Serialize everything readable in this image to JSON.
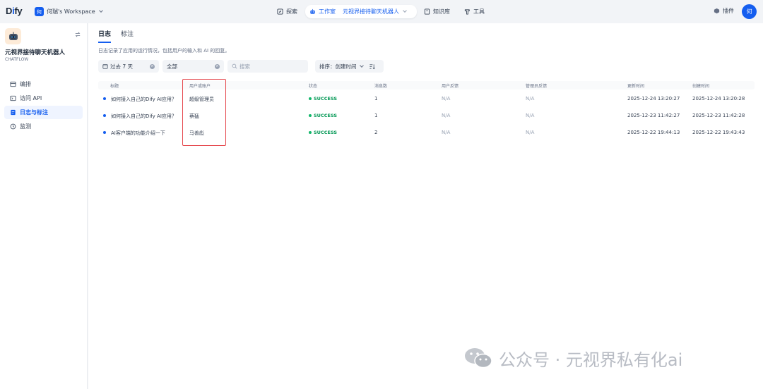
{
  "topbar": {
    "logo_prefix": "D",
    "logo_i": "i",
    "logo_suffix": "fy",
    "workspace_avatar": "何",
    "workspace_name": "何瑞's Workspace",
    "nav": {
      "explore": "探索",
      "studio": "工作室",
      "studio_app": "元视界接待聊天机器人",
      "knowledge": "知识库",
      "tools": "工具"
    },
    "plugin": "插件",
    "user_avatar": "何"
  },
  "sidebar": {
    "app_name": "元视界接待聊天机器人",
    "app_type": "CHATFLOW",
    "items": [
      {
        "label": "编排",
        "icon": "layout-icon"
      },
      {
        "label": "访问 API",
        "icon": "terminal-icon"
      },
      {
        "label": "日志与标注",
        "icon": "file-text-icon",
        "active": true
      },
      {
        "label": "监测",
        "icon": "monitor-icon"
      }
    ]
  },
  "main": {
    "tabs": [
      "日志",
      "标注"
    ],
    "description": "日志记录了应用的运行情况，包括用户的输入和 AI 的回复。",
    "filters": {
      "period": "过去 7 天",
      "status": "全部",
      "search_placeholder": "搜索",
      "sort": "排序：创建时间"
    },
    "table": {
      "headers": [
        "标题",
        "用户或账户",
        "状态",
        "消息数",
        "用户反馈",
        "管理员反馈",
        "更新时间",
        "创建时间"
      ],
      "rows": [
        {
          "title": "如何接入自己的Dify AI应用？",
          "user": "超级管理员",
          "status": "SUCCESS",
          "messages": "1",
          "user_feedback": "N/A",
          "admin_feedback": "N/A",
          "updated": "2025-12-24 13:20:27",
          "created": "2025-12-24 13:20:28"
        },
        {
          "title": "如何接入自己的Dify AI应用？",
          "user": "蔡猛",
          "status": "SUCCESS",
          "messages": "1",
          "user_feedback": "N/A",
          "admin_feedback": "N/A",
          "updated": "2025-12-23 11:42:27",
          "created": "2025-12-23 11:42:28"
        },
        {
          "title": "AI客户端的功能介绍一下",
          "user": "马善彪",
          "status": "SUCCESS",
          "messages": "2",
          "user_feedback": "N/A",
          "admin_feedback": "N/A",
          "updated": "2025-12-22 19:44:13",
          "created": "2025-12-22 19:43:43"
        }
      ]
    }
  },
  "watermark": "公众号 · 元视界私有化ai",
  "colors": {
    "accent": "#155eef",
    "success": "#039855",
    "highlight": "#e5484d"
  }
}
